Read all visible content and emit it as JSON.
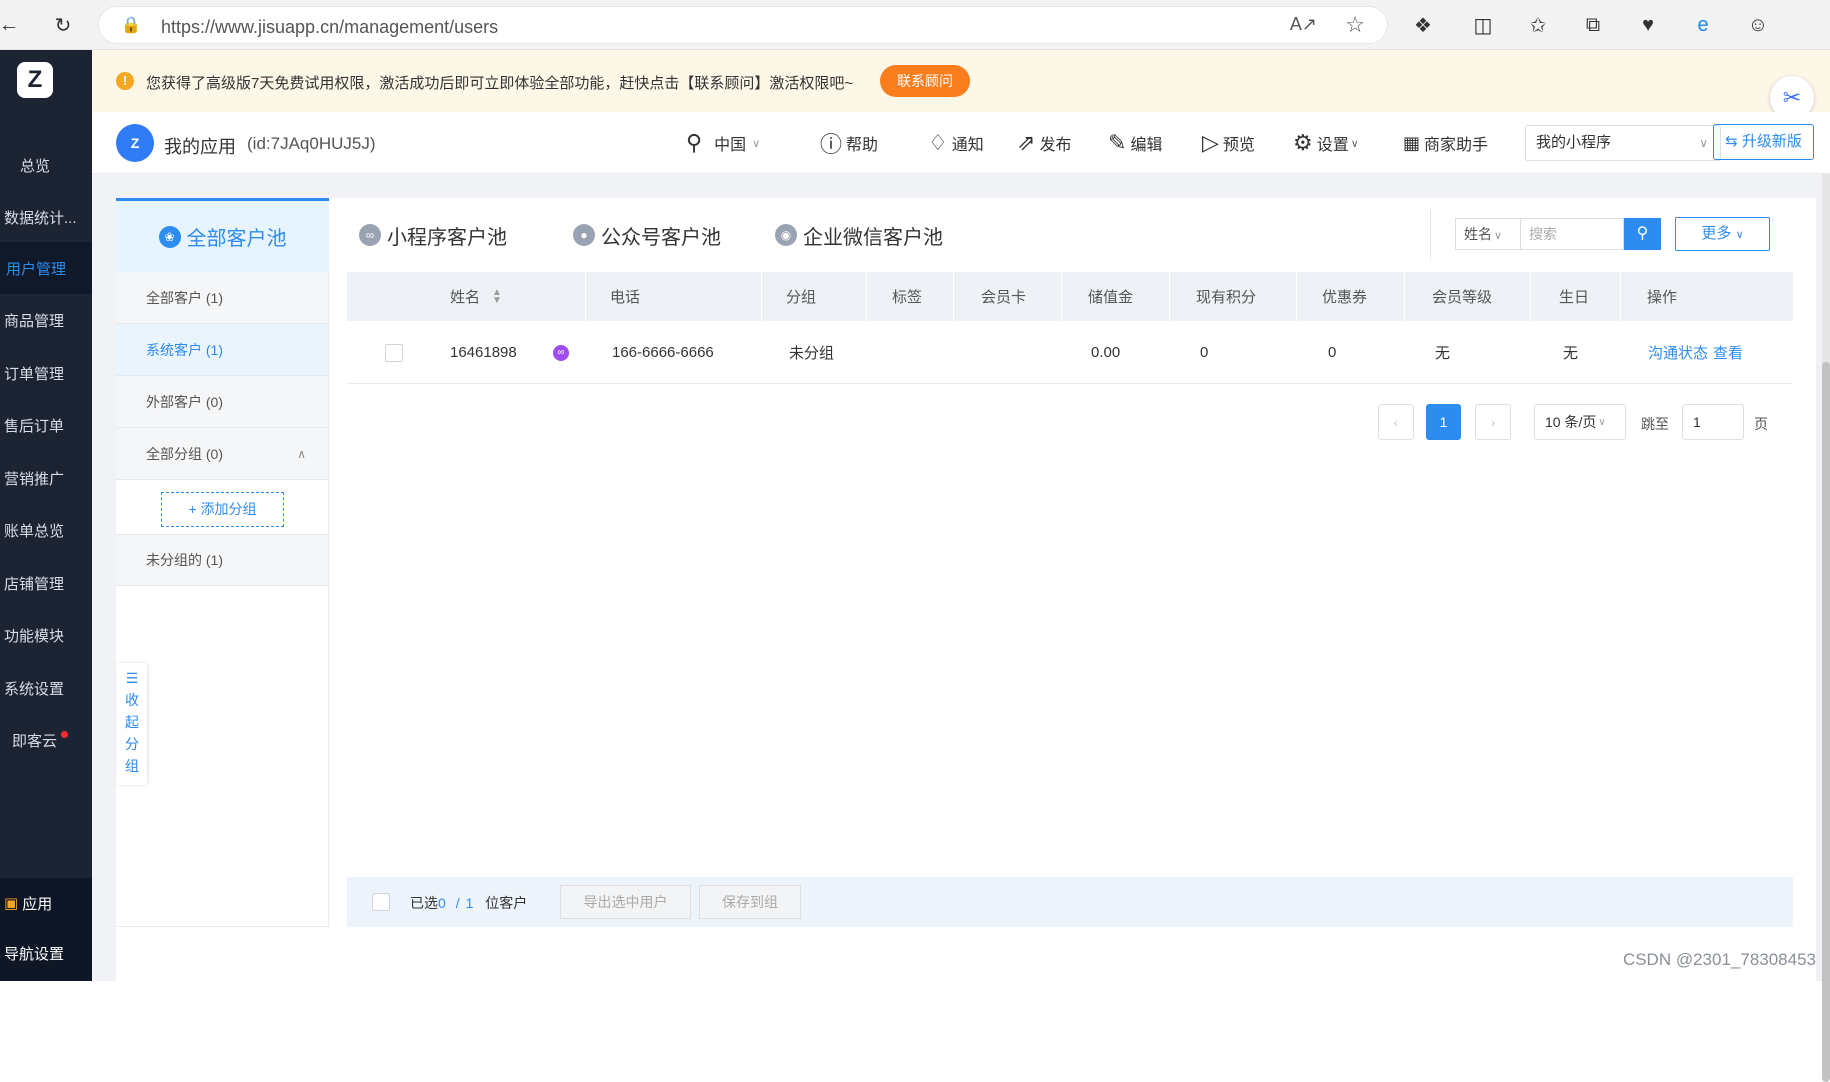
{
  "browser": {
    "url": "https://www.jisuapp.cn/management/users",
    "icons": [
      "back-icon",
      "reload-icon",
      "lock-icon",
      "read-aloud-icon",
      "favorite-star-icon",
      "extensions-icon",
      "split-screen-icon",
      "favorites-icon",
      "collections-icon",
      "performance-icon",
      "edge-icon",
      "profile-icon"
    ]
  },
  "sidebar": {
    "items": [
      {
        "label": "总览"
      },
      {
        "label": "数据统计..."
      },
      {
        "label": "用户管理",
        "active": true
      },
      {
        "label": "商品管理"
      },
      {
        "label": "订单管理"
      },
      {
        "label": "售后订单"
      },
      {
        "label": "营销推广"
      },
      {
        "label": "账单总览"
      },
      {
        "label": "店铺管理"
      },
      {
        "label": "功能模块"
      },
      {
        "label": "系统设置"
      },
      {
        "label": "即客云"
      }
    ],
    "bottom": {
      "app": "应用",
      "nav_settings": "导航设置"
    }
  },
  "banner": {
    "text": "您获得了高级版7天免费试用权限，激活成功后即可立即体验全部功能，赶快点击【联系顾问】激活权限吧~",
    "button": "联系顾问"
  },
  "header": {
    "app_name": "我的应用",
    "app_id": "(id:7JAq0HUJ5J)",
    "region": "中国",
    "help": "帮助",
    "notify": "通知",
    "publish": "发布",
    "edit": "编辑",
    "preview": "预览",
    "settings": "设置",
    "merchant": "商家助手",
    "select_value": "我的小程序",
    "upgrade": "升级新版"
  },
  "pools": {
    "all": "全部客户池",
    "miniprogram": "小程序客户池",
    "official": "公众号客户池",
    "wecom": "企业微信客户池"
  },
  "search": {
    "type": "姓名",
    "placeholder": "搜索",
    "more": "更多"
  },
  "groups": {
    "all_customers": "全部客户 (1)",
    "system_customers": "系统客户 (1)",
    "external_customers": "外部客户 (0)",
    "all_groups": "全部分组 (0)",
    "add_group": "+ 添加分组",
    "ungrouped": "未分组的 (1)",
    "collapse": [
      "收",
      "起",
      "分",
      "组"
    ]
  },
  "table": {
    "columns": [
      "姓名",
      "电话",
      "分组",
      "标签",
      "会员卡",
      "储值金",
      "现有积分",
      "优惠券",
      "会员等级",
      "生日",
      "操作"
    ],
    "rows": [
      {
        "name": "16461898",
        "phone": "166-6666-6666",
        "group": "未分组",
        "tag": "",
        "card": "",
        "balance": "0.00",
        "points": "0",
        "coupons": "0",
        "level": "无",
        "birthday": "无",
        "action_status": "沟通状态",
        "action_view": "查看"
      }
    ]
  },
  "pagination": {
    "current": "1",
    "page_size": "10 条/页",
    "goto_label": "跳至",
    "goto_value": "1",
    "page_unit": "页"
  },
  "footer": {
    "selected_prefix": "已选",
    "selected": "0",
    "separator": "/",
    "total": "1",
    "suffix": "位客户",
    "export": "导出选中用户",
    "save": "保存到组"
  },
  "watermark": "CSDN @2301_78308453",
  "colors": {
    "accent": "#2d8cf0",
    "sidebar": "#1c2433",
    "banner_btn": "#fa7e1e"
  }
}
